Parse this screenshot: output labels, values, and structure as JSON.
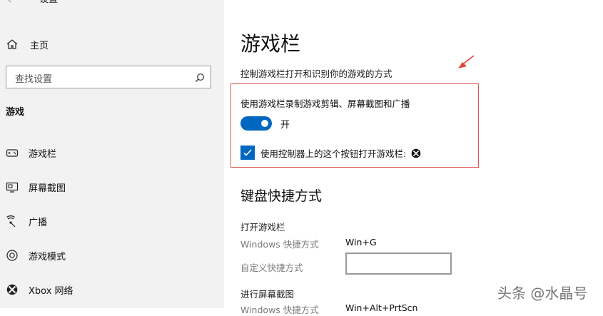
{
  "window": {
    "title": "设置",
    "back_icon": "back-arrow-icon"
  },
  "sidebar": {
    "home_label": "主页",
    "search_placeholder": "查找设置",
    "section_label": "游戏",
    "items": [
      {
        "label": "游戏栏",
        "icon": "gamebar-icon"
      },
      {
        "label": "屏幕截图",
        "icon": "screenshot-icon"
      },
      {
        "label": "广播",
        "icon": "broadcast-icon"
      },
      {
        "label": "游戏模式",
        "icon": "gamemode-icon"
      },
      {
        "label": "Xbox 网络",
        "icon": "xbox-icon"
      }
    ]
  },
  "main": {
    "title": "游戏栏",
    "description": "控制游戏栏打开和识别你的游戏的方式",
    "record_label": "使用游戏栏录制游戏剪辑、屏幕截图和广播",
    "toggle_state": "开",
    "toggle_on": true,
    "checkbox_label": "使用控制器上的这个按钮打开游戏栏:",
    "checkbox_checked": true,
    "keyboard_title": "键盘快捷方式",
    "open_gamebar": {
      "title": "打开游戏栏",
      "windows_label": "Windows 快捷方式",
      "windows_value": "Win+G",
      "custom_label": "自定义快捷方式",
      "custom_value": ""
    },
    "screenshot": {
      "title": "进行屏幕截图",
      "windows_label": "Windows 快捷方式",
      "windows_value": "Win+Alt+PrtScn"
    }
  },
  "colors": {
    "accent": "#0067c0",
    "highlight_border": "#d9534f",
    "arrow": "#e0453a"
  },
  "watermark": "头条 @水晶号"
}
